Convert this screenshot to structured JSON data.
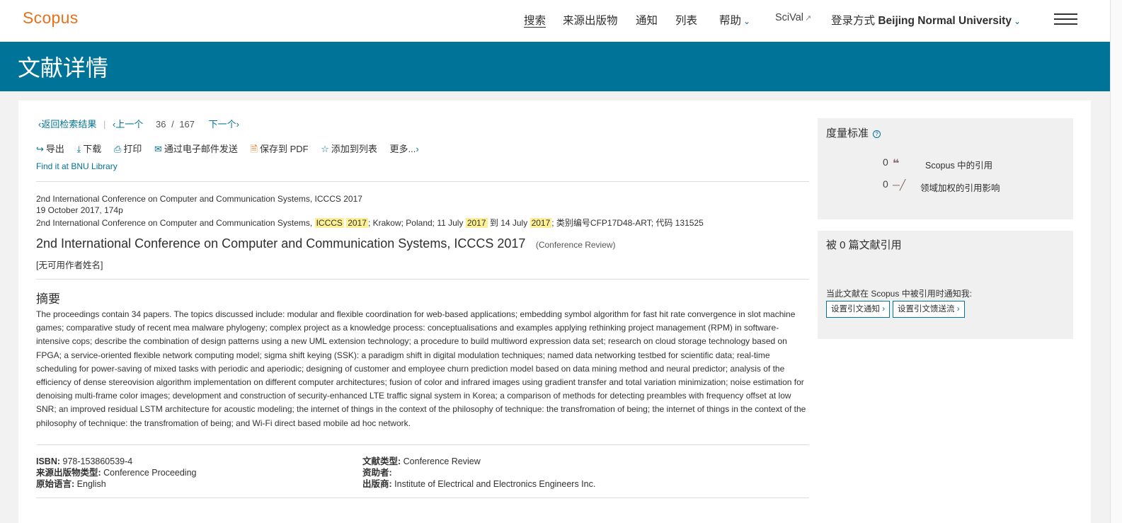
{
  "header": {
    "logo": "Scopus",
    "nav": {
      "search": "搜索",
      "sources": "来源出版物",
      "alerts": "通知",
      "lists": "列表",
      "help": "帮助",
      "scival": "SciVal",
      "login_prefix": "登录方式",
      "institution": "Beijing Normal University"
    }
  },
  "banner": {
    "title": "文献详情"
  },
  "result_nav": {
    "back": "返回检索结果",
    "prev": "上一个",
    "current": "36",
    "separator": "/",
    "total": "167",
    "next": "下一个"
  },
  "actions": {
    "export": "导出",
    "download": "下载",
    "print": "打印",
    "email": "通过电子邮件发送",
    "save_pdf": "保存到 PDF",
    "add_list": "添加到列表",
    "more": "更多..."
  },
  "library_link": "Find it at BNU Library",
  "source": {
    "line1": "2nd International Conference on Computer and Communication Systems, ICCCS 2017",
    "line2": "19 October 2017, 174p",
    "line3_a": "2nd International Conference on Computer and Communication Systems,",
    "line3_hl1": "ICCCS",
    "line3_hl2": "2017",
    "line3_b": "; Krakow; Poland; 11 July",
    "line3_hl3": "2017",
    "line3_c": "到 14 July",
    "line3_hl4": "2017",
    "line3_d": "; 类别编号CFP17D48-ART; 代码 131525"
  },
  "document": {
    "title": "2nd International Conference on Computer and Communication Systems, ICCCS 2017",
    "type": "(Conference Review)",
    "authors": "[无可用作者姓名]"
  },
  "abstract": {
    "heading": "摘要",
    "text": "The proceedings contain 34 papers. The topics discussed include: modular and flexible coordination for web-based applications; embedding symbol algorithm for fast hit rate convergence in slot machine games; comparative study of recent mea malware phylogeny; complex project as a knowledge process: conceptualisations and examples applying rethinking project management (RPM) in software-intensive cops; describe the combination of design patterns using a new UML extension technology; a procedure to build multiword expression data set; research on cloud storage technology based on FPGA; a service-oriented flexible network computing model; sigma shift keying (SSK): a paradigm shift in digital modulation techniques; named data networking testbed for scientific data; real-time scheduling for power-saving of mixed tasks with periodic and aperiodic; designing of customer and employee churn prediction model based on data mining method and neural predictor; analysis of the efficiency of dense stereovision algorithm implementation on different computer architectures; fusion of color and infrared images using gradient transfer and total variation minimization; noise estimation for denoising multi-frame color images; development and construction of security-enhanced LTE traffic signal system in Korea; a comparison of methods for detecting preambles with frequency offset at low SNR; an improved residual LSTM architecture for acoustic modeling; the internet of things in the context of the philosophy of technique: the transfromation of being; the internet of things in the context of the philosophy of technique: the transfromation of being; and Wi-Fi direct based mobile ad hoc network."
  },
  "details": {
    "isbn_label": "ISBN:",
    "isbn": "978-153860539-4",
    "source_type_label": "来源出版物类型:",
    "source_type": "Conference Proceeding",
    "language_label": "原始语言:",
    "language": "English",
    "doc_type_label": "文献类型:",
    "doc_type": "Conference Review",
    "sponsor_label": "资助者:",
    "sponsor": "",
    "publisher_label": "出版商:",
    "publisher": "Institute of Electrical and Electronics Engineers Inc."
  },
  "metrics": {
    "title": "度量标准",
    "help": "?",
    "citations_value": "0",
    "citations_label": "Scopus 中的引用",
    "fwci_value": "0",
    "fwci_label": "领域加权的引用影响"
  },
  "cited_by": {
    "title": "被 0 篇文献引用",
    "notify_text": "当此文献在 Scopus 中被引用时通知我:",
    "alert_button": "设置引文通知",
    "feed_button": "设置引文馈送流"
  },
  "colors": {
    "brand_orange": "#e9711c",
    "banner_blue": "#007398",
    "highlight": "#fcef94"
  },
  "icons": {
    "export": "export-icon",
    "download": "download-icon",
    "print": "print-icon",
    "email": "email-icon",
    "pdf": "pdf-icon",
    "star": "star-icon",
    "quote": "quote-icon",
    "scale": "scale-icon"
  }
}
